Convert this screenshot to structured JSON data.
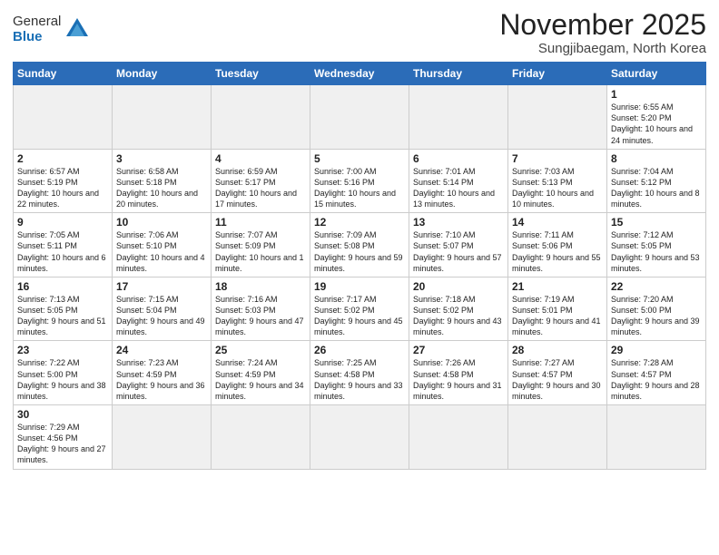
{
  "header": {
    "logo_general": "General",
    "logo_blue": "Blue",
    "month_title": "November 2025",
    "subtitle": "Sungjibaegam, North Korea"
  },
  "weekdays": [
    "Sunday",
    "Monday",
    "Tuesday",
    "Wednesday",
    "Thursday",
    "Friday",
    "Saturday"
  ],
  "weeks": [
    [
      {
        "day": "",
        "info": ""
      },
      {
        "day": "",
        "info": ""
      },
      {
        "day": "",
        "info": ""
      },
      {
        "day": "",
        "info": ""
      },
      {
        "day": "",
        "info": ""
      },
      {
        "day": "",
        "info": ""
      },
      {
        "day": "1",
        "info": "Sunrise: 6:55 AM\nSunset: 5:20 PM\nDaylight: 10 hours\nand 24 minutes."
      }
    ],
    [
      {
        "day": "2",
        "info": "Sunrise: 6:57 AM\nSunset: 5:19 PM\nDaylight: 10 hours\nand 22 minutes."
      },
      {
        "day": "3",
        "info": "Sunrise: 6:58 AM\nSunset: 5:18 PM\nDaylight: 10 hours\nand 20 minutes."
      },
      {
        "day": "4",
        "info": "Sunrise: 6:59 AM\nSunset: 5:17 PM\nDaylight: 10 hours\nand 17 minutes."
      },
      {
        "day": "5",
        "info": "Sunrise: 7:00 AM\nSunset: 5:16 PM\nDaylight: 10 hours\nand 15 minutes."
      },
      {
        "day": "6",
        "info": "Sunrise: 7:01 AM\nSunset: 5:14 PM\nDaylight: 10 hours\nand 13 minutes."
      },
      {
        "day": "7",
        "info": "Sunrise: 7:03 AM\nSunset: 5:13 PM\nDaylight: 10 hours\nand 10 minutes."
      },
      {
        "day": "8",
        "info": "Sunrise: 7:04 AM\nSunset: 5:12 PM\nDaylight: 10 hours\nand 8 minutes."
      }
    ],
    [
      {
        "day": "9",
        "info": "Sunrise: 7:05 AM\nSunset: 5:11 PM\nDaylight: 10 hours\nand 6 minutes."
      },
      {
        "day": "10",
        "info": "Sunrise: 7:06 AM\nSunset: 5:10 PM\nDaylight: 10 hours\nand 4 minutes."
      },
      {
        "day": "11",
        "info": "Sunrise: 7:07 AM\nSunset: 5:09 PM\nDaylight: 10 hours\nand 1 minute."
      },
      {
        "day": "12",
        "info": "Sunrise: 7:09 AM\nSunset: 5:08 PM\nDaylight: 9 hours\nand 59 minutes."
      },
      {
        "day": "13",
        "info": "Sunrise: 7:10 AM\nSunset: 5:07 PM\nDaylight: 9 hours\nand 57 minutes."
      },
      {
        "day": "14",
        "info": "Sunrise: 7:11 AM\nSunset: 5:06 PM\nDaylight: 9 hours\nand 55 minutes."
      },
      {
        "day": "15",
        "info": "Sunrise: 7:12 AM\nSunset: 5:05 PM\nDaylight: 9 hours\nand 53 minutes."
      }
    ],
    [
      {
        "day": "16",
        "info": "Sunrise: 7:13 AM\nSunset: 5:05 PM\nDaylight: 9 hours\nand 51 minutes."
      },
      {
        "day": "17",
        "info": "Sunrise: 7:15 AM\nSunset: 5:04 PM\nDaylight: 9 hours\nand 49 minutes."
      },
      {
        "day": "18",
        "info": "Sunrise: 7:16 AM\nSunset: 5:03 PM\nDaylight: 9 hours\nand 47 minutes."
      },
      {
        "day": "19",
        "info": "Sunrise: 7:17 AM\nSunset: 5:02 PM\nDaylight: 9 hours\nand 45 minutes."
      },
      {
        "day": "20",
        "info": "Sunrise: 7:18 AM\nSunset: 5:02 PM\nDaylight: 9 hours\nand 43 minutes."
      },
      {
        "day": "21",
        "info": "Sunrise: 7:19 AM\nSunset: 5:01 PM\nDaylight: 9 hours\nand 41 minutes."
      },
      {
        "day": "22",
        "info": "Sunrise: 7:20 AM\nSunset: 5:00 PM\nDaylight: 9 hours\nand 39 minutes."
      }
    ],
    [
      {
        "day": "23",
        "info": "Sunrise: 7:22 AM\nSunset: 5:00 PM\nDaylight: 9 hours\nand 38 minutes."
      },
      {
        "day": "24",
        "info": "Sunrise: 7:23 AM\nSunset: 4:59 PM\nDaylight: 9 hours\nand 36 minutes."
      },
      {
        "day": "25",
        "info": "Sunrise: 7:24 AM\nSunset: 4:59 PM\nDaylight: 9 hours\nand 34 minutes."
      },
      {
        "day": "26",
        "info": "Sunrise: 7:25 AM\nSunset: 4:58 PM\nDaylight: 9 hours\nand 33 minutes."
      },
      {
        "day": "27",
        "info": "Sunrise: 7:26 AM\nSunset: 4:58 PM\nDaylight: 9 hours\nand 31 minutes."
      },
      {
        "day": "28",
        "info": "Sunrise: 7:27 AM\nSunset: 4:57 PM\nDaylight: 9 hours\nand 30 minutes."
      },
      {
        "day": "29",
        "info": "Sunrise: 7:28 AM\nSunset: 4:57 PM\nDaylight: 9 hours\nand 28 minutes."
      }
    ],
    [
      {
        "day": "30",
        "info": "Sunrise: 7:29 AM\nSunset: 4:56 PM\nDaylight: 9 hours\nand 27 minutes."
      },
      {
        "day": "",
        "info": ""
      },
      {
        "day": "",
        "info": ""
      },
      {
        "day": "",
        "info": ""
      },
      {
        "day": "",
        "info": ""
      },
      {
        "day": "",
        "info": ""
      },
      {
        "day": "",
        "info": ""
      }
    ]
  ]
}
